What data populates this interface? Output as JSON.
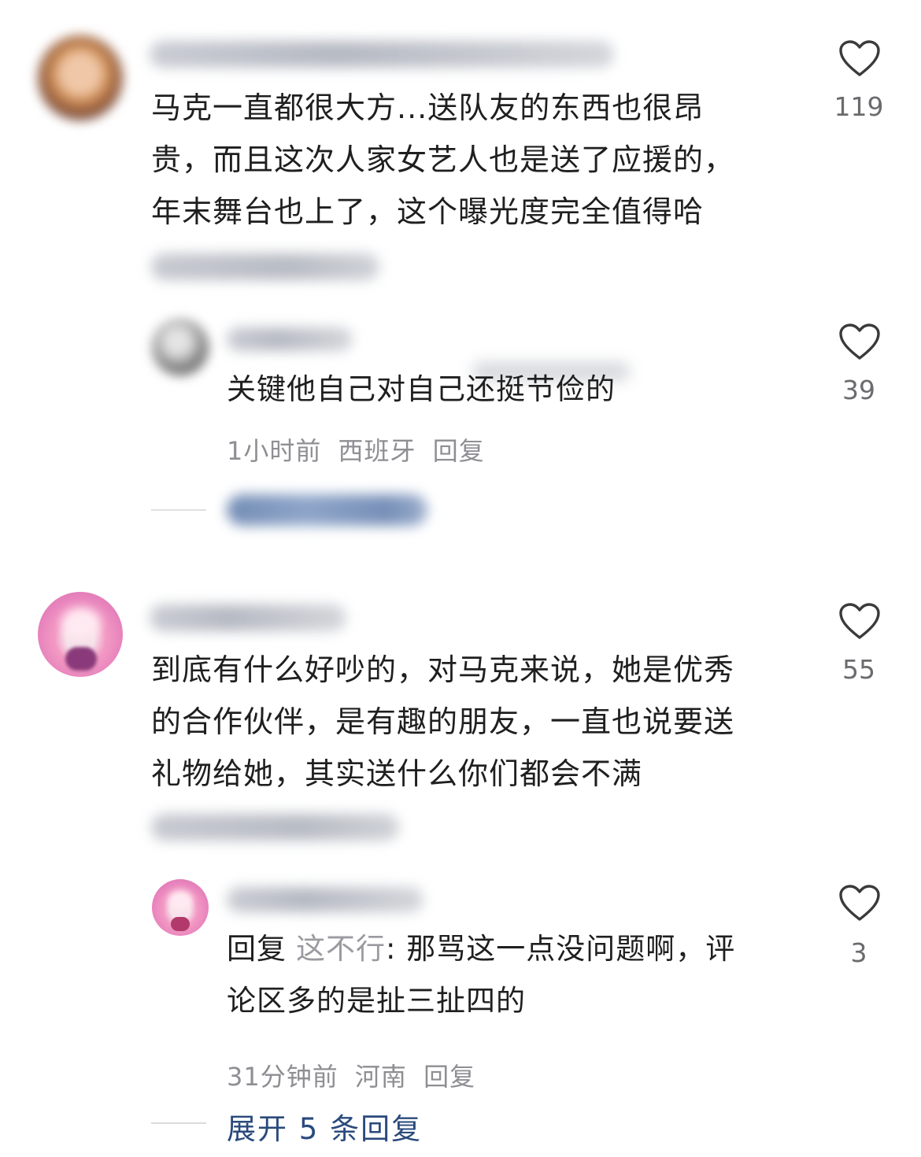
{
  "comments": [
    {
      "text": "马克一直都很大方...送队友的东西也很昂贵，而且这次人家女艺人也是送了应援的，年末舞台也上了，这个曝光度完全值得哈",
      "lines": [
        "马克一直都很大方...送队友的东西也很昂",
        "贵，而且这次人家女艺人也是送了应援的，",
        "年末舞台也上了，这个曝光度完全值得哈"
      ],
      "likes": "119",
      "reply": {
        "text": "关键他自己对自己还挺节俭的",
        "time": "1小时前",
        "location": "西班牙",
        "reply_label": "回复",
        "likes": "39"
      }
    },
    {
      "text": "到底有什么好吵的，对马克来说，她是优秀的合作伙伴，是有趣的朋友，一直也说要送礼物给她，其实送什么你们都会不满",
      "lines": [
        "到底有什么好吵的，对马克来说，她是优秀",
        "的合作伙伴，是有趣的朋友，一直也说要送",
        "礼物给她，其实送什么你们都会不满"
      ],
      "likes": "55",
      "reply": {
        "prefix": "回复",
        "mention": "这不行",
        "text_line1": ": 那骂这一点没问题啊，评",
        "text_line2": "论区多的是扯三扯四的",
        "time": "31分钟前",
        "location": "河南",
        "reply_label": "回复",
        "likes": "3"
      },
      "expand_label": "展开 5 条回复"
    }
  ],
  "icons": {
    "like": "heart-outline-icon"
  },
  "colors": {
    "text": "#1f1f1f",
    "meta": "#8e8e93",
    "link": "#2a4a7c"
  }
}
